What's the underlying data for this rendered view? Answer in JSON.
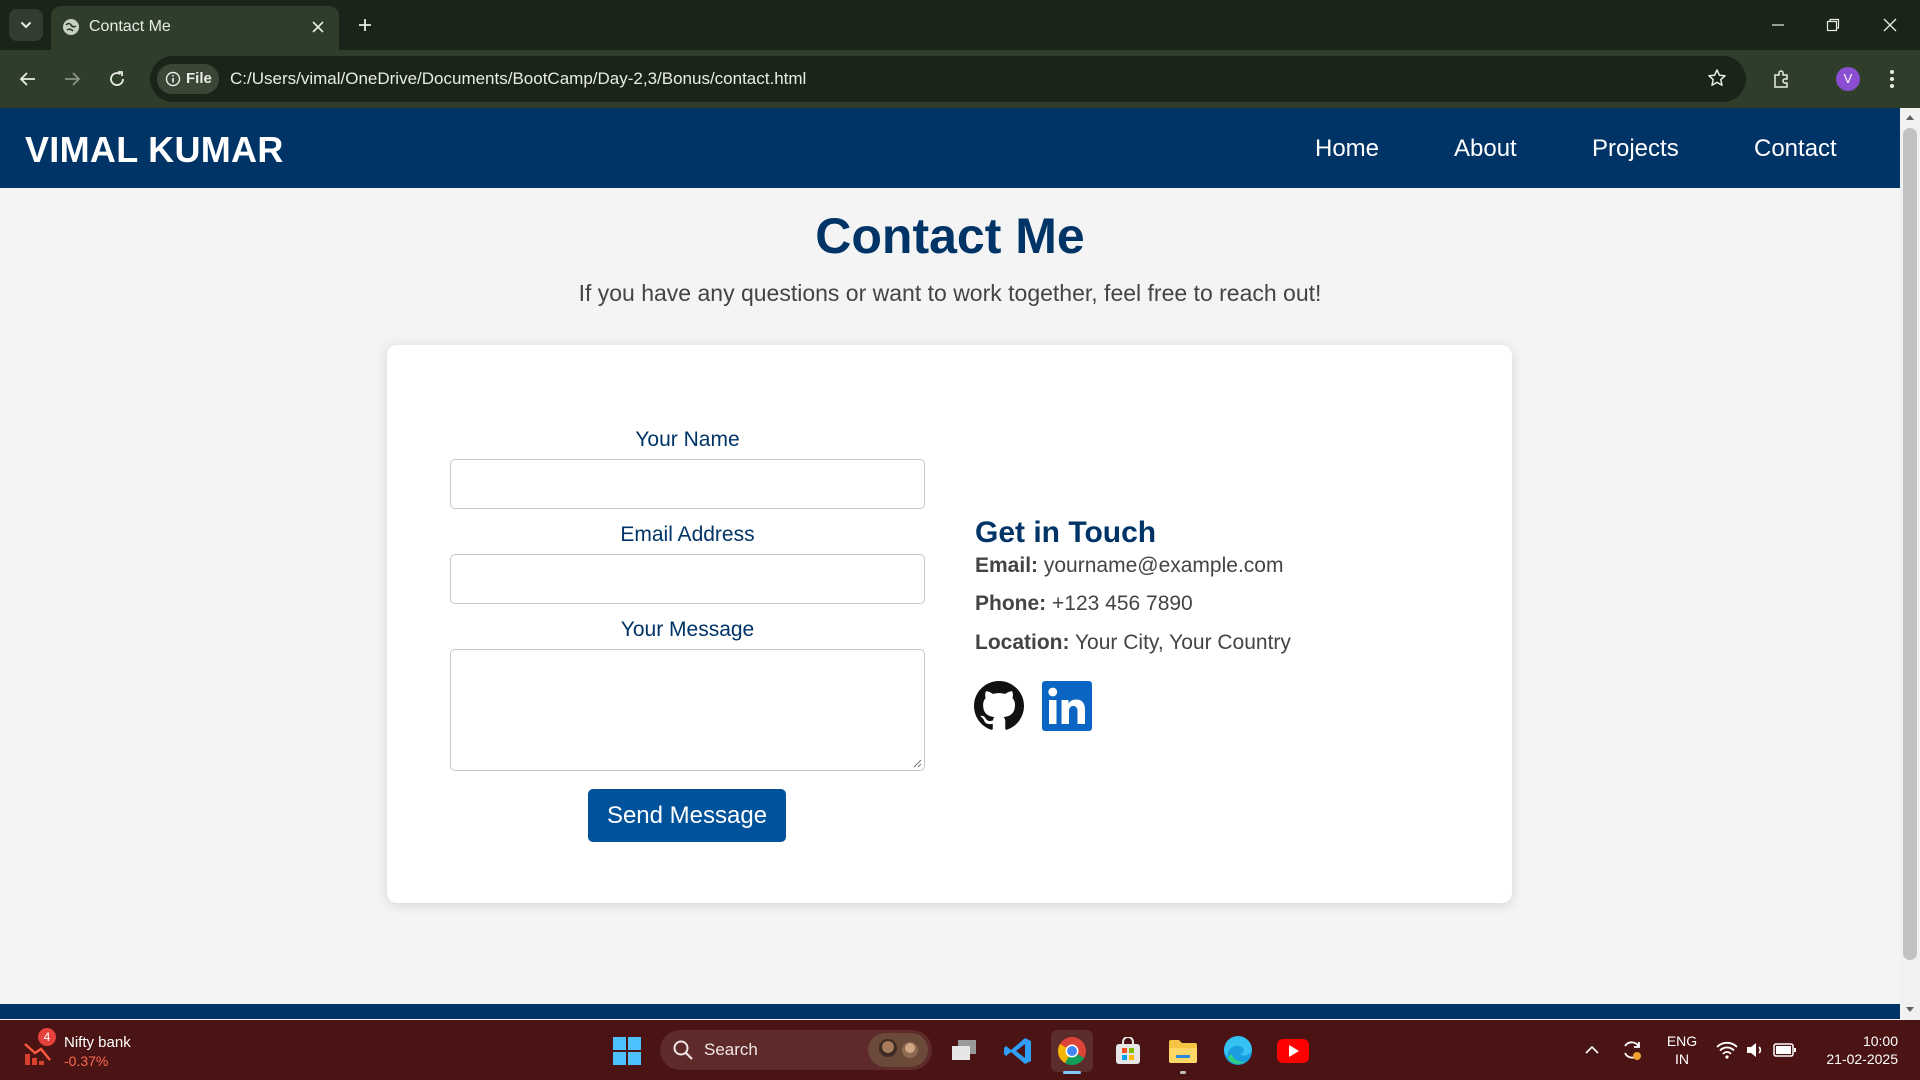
{
  "browser": {
    "tab_title": "Contact Me",
    "site_chip_label": "File",
    "url": "C:/Users/vimal/OneDrive/Documents/BootCamp/Day-2,3/Bonus/contact.html",
    "profile_initial": "V"
  },
  "site": {
    "brand": "VIMAL KUMAR",
    "nav": [
      "Home",
      "About",
      "Projects",
      "Contact"
    ]
  },
  "page": {
    "title": "Contact Me",
    "subtitle": "If you have any questions or want to work together, feel free to reach out!"
  },
  "form": {
    "name_label": "Your Name",
    "name_value": "",
    "email_label": "Email Address",
    "email_value": "",
    "message_label": "Your Message",
    "message_value": "",
    "submit_label": "Send Message"
  },
  "contact": {
    "heading": "Get in Touch",
    "email_label": "Email:",
    "email_value": "yourname@example.com",
    "phone_label": "Phone:",
    "phone_value": "+123 456 7890",
    "location_label": "Location:",
    "location_value": "Your City, Your Country",
    "social_icons": [
      "github-icon",
      "linkedin-icon"
    ]
  },
  "taskbar": {
    "widget_badge": "4",
    "widget_title": "Nifty bank",
    "widget_change": "-0.37%",
    "search_label": "Search",
    "lang_line1": "ENG",
    "lang_line2": "IN",
    "time": "10:00",
    "date": "21-02-2025"
  },
  "colors": {
    "brand_navy": "#003366",
    "button_blue": "#00529b",
    "browser_frame": "#2f3d2b",
    "taskbar": "#4a1414"
  }
}
